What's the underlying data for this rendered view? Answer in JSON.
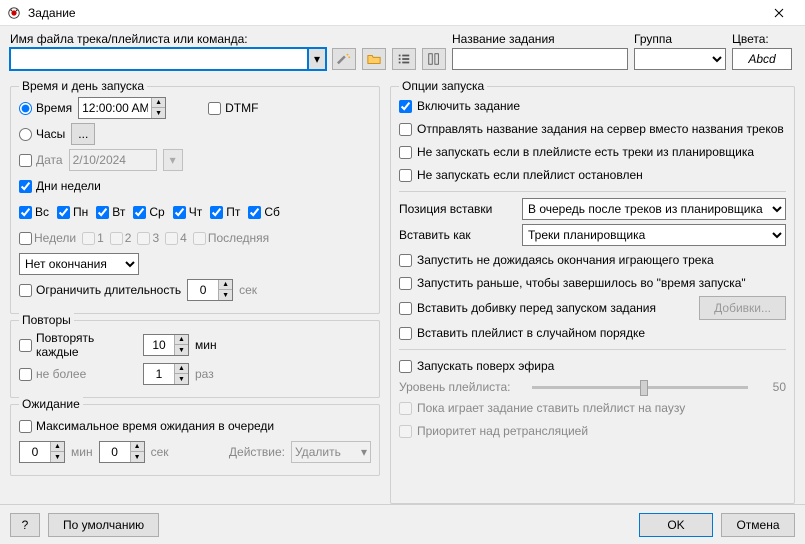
{
  "window": {
    "title": "Задание"
  },
  "top": {
    "track_label": "Имя файла трека/плейлиста или команда:",
    "track_value": "",
    "task_name_label": "Название задания",
    "task_name_value": "",
    "group_label": "Группа",
    "group_value": "",
    "colors_label": "Цвета:",
    "colors_value": "Abcd"
  },
  "time": {
    "legend": "Время и день запуска",
    "time_label": "Время",
    "time_value": "12:00:00 AM",
    "dtmf_label": "DTMF",
    "hours_label": "Часы",
    "date_label": "Дата",
    "date_value": "2/10/2024",
    "days_label": "Дни недели",
    "days": [
      "Вс",
      "Пн",
      "Вт",
      "Ср",
      "Чт",
      "Пт",
      "Сб"
    ],
    "weeks_label": "Недели",
    "weeks": [
      "1",
      "2",
      "3",
      "4"
    ],
    "last_label": "Последняя",
    "ending_value": "Нет окончания",
    "limit_label": "Ограничить длительность",
    "limit_value": "0",
    "sec_label": "сек"
  },
  "repeats": {
    "legend": "Повторы",
    "every_label": "Повторять каждые",
    "every_value": "10",
    "min_label": "мин",
    "nomore_label": "не более",
    "nomore_value": "1",
    "times_label": "раз"
  },
  "wait": {
    "legend": "Ожидание",
    "max_label": "Максимальное время ожидания в очереди",
    "min_value": "0",
    "min_label": "мин",
    "sec_value": "0",
    "sec_label": "сек",
    "action_label": "Действие:",
    "action_value": "Удалить"
  },
  "launch": {
    "legend": "Опции запуска",
    "enable_label": "Включить задание",
    "send_name_label": "Отправлять название задания на сервер вместо названия треков",
    "no_if_scheduled_label": "Не запускать если в плейлисте есть треки из планировщика",
    "no_if_stopped_label": "Не запускать если плейлист остановлен",
    "insert_pos_label": "Позиция вставки",
    "insert_pos_value": "В очередь после треков из планировщика",
    "insert_as_label": "Вставить как",
    "insert_as_value": "Треки планировщика",
    "no_wait_label": "Запустить не дожидаясь окончания играющего трека",
    "start_early_label": "Запустить раньше, чтобы завершилось во \"время запуска\"",
    "jingle_label": "Вставить добивку перед запуском задания",
    "jingle_btn": "Добивки...",
    "shuffle_label": "Вставить плейлист в случайном порядке",
    "over_air_label": "Запускать поверх эфира",
    "level_label": "Уровень плейлиста:",
    "level_value": "50",
    "pause_label": "Пока играет задание ставить плейлист на паузу",
    "priority_label": "Приоритет над ретрансляцией"
  },
  "footer": {
    "help": "?",
    "default": "По умолчанию",
    "ok": "OK",
    "cancel": "Отмена"
  }
}
